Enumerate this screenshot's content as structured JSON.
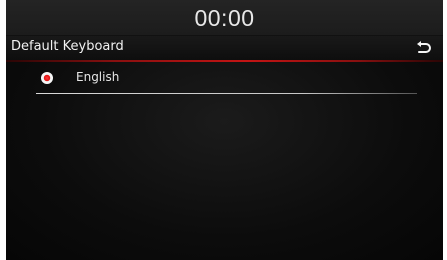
{
  "status_bar": {
    "clock": "00:00"
  },
  "header": {
    "title": "Default Keyboard",
    "back_icon": "return-arrow-icon"
  },
  "keyboard_list": {
    "items": [
      {
        "label": "English",
        "selected": true
      }
    ]
  },
  "colors": {
    "accent": "#d01818",
    "background": "#0a0a0a",
    "text": "#f0f0f0"
  }
}
